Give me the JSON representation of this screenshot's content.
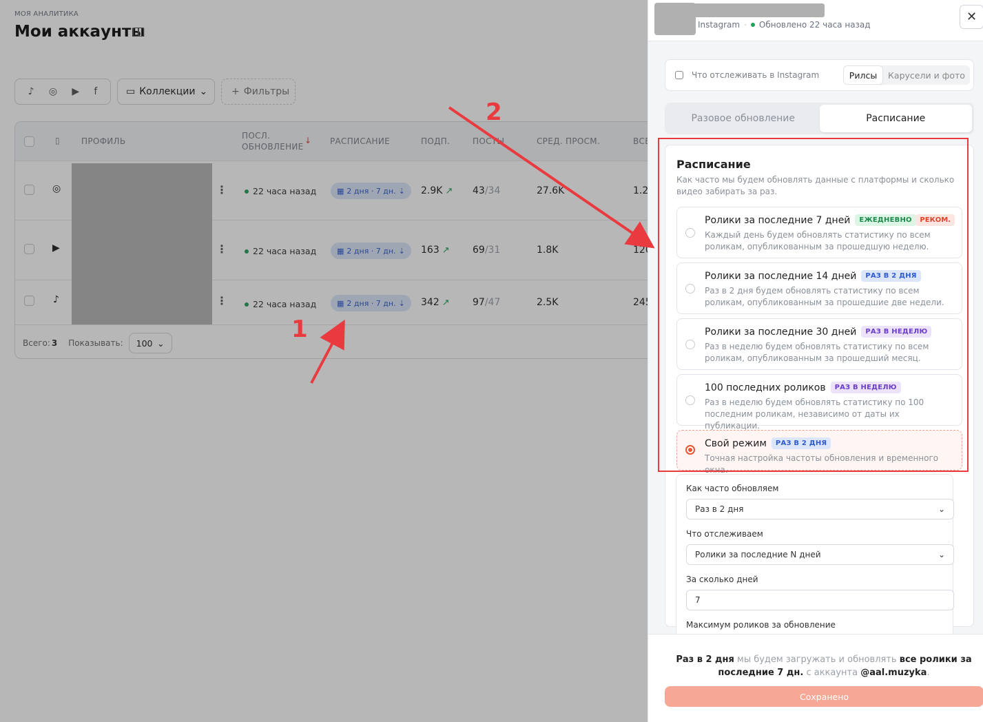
{
  "header": {
    "breadcrumb": "МОЯ АНАЛИТИКА",
    "title": "Мои аккаунты"
  },
  "toolbar": {
    "platforms": [
      "tiktok-icon",
      "instagram-icon",
      "youtube-icon",
      "facebook-icon"
    ],
    "collections_label": "Коллекции",
    "filters_label": "Фильтры"
  },
  "table": {
    "headers": {
      "profile": "ПРОФИЛЬ",
      "last_update_1": "ПОСЛ.",
      "last_update_2": "ОБНОВЛЕНИЕ",
      "schedule": "РАСПИСАНИЕ",
      "subs": "ПОДП.",
      "posts": "ПОСТЫ",
      "avg_views": "СРЕД. ПРОСМ.",
      "total": "ВСЕ"
    },
    "rows": [
      {
        "platform": "instagram",
        "updated": "22 часа назад",
        "schedule": "2 дня · 7 дн.",
        "subs": "2.9K",
        "posts_a": "43",
        "posts_b": "/34",
        "avg": "27.6K",
        "total": "1.2"
      },
      {
        "platform": "youtube",
        "updated": "22 часа назад",
        "schedule": "2 дня · 7 дн.",
        "subs": "163",
        "posts_a": "69",
        "posts_b": "/31",
        "avg": "1.8K",
        "total": "120"
      },
      {
        "platform": "tiktok",
        "updated": "22 часа назад",
        "schedule": "2 дня · 7 дн.",
        "subs": "342",
        "posts_a": "97",
        "posts_b": "/47",
        "avg": "2.5K",
        "total": "245"
      }
    ],
    "footer": {
      "total_label": "Всего:",
      "total_value": "3",
      "show_label": "Показывать:",
      "page_size": "100"
    }
  },
  "panel": {
    "platform": "Instagram",
    "updated": "Обновлено 22 часа назад",
    "track_label": "Что отслеживать в Instagram",
    "track_tabs": [
      "Рилсы",
      "Карусели и фото"
    ],
    "mode_tabs": [
      "Разовое обновление",
      "Расписание"
    ],
    "schedule": {
      "title": "Расписание",
      "desc": "Как часто мы будем обновлять данные с платформы и сколько видео забирать за раз.",
      "options": [
        {
          "title": "Ролики за последние 7 дней",
          "badge": "ЕЖЕДНЕВНО",
          "rec": "РЕКОМ.",
          "desc": "Каждый день будем обновлять статистику по всем роликам, опубликованным за прошедшую неделю."
        },
        {
          "title": "Ролики за последние 14 дней",
          "badge": "РАЗ В 2 ДНЯ",
          "desc": "Раз в 2 дня будем обновлять статистику по всем роликам, опубликованным за прошедшие две недели."
        },
        {
          "title": "Ролики за последние 30 дней",
          "badge": "РАЗ В НЕДЕЛЮ",
          "desc": "Раз в неделю будем обновлять статистику по всем роликам, опубликованным за прошедший месяц."
        },
        {
          "title": "100 последних роликов",
          "badge": "РАЗ В НЕДЕЛЮ",
          "desc": "Раз в неделю будем обновлять статистику по 100 последним роликам, независимо от даты их публикации."
        },
        {
          "title": "Свой режим",
          "badge": "РАЗ В 2 ДНЯ",
          "desc": "Точная настройка частоты обновления и временного окна."
        }
      ]
    },
    "custom": {
      "freq_label": "Как часто обновляем",
      "freq_value": "Раз в 2 дня",
      "what_label": "Что отслеживаем",
      "what_value": "Ролики за последние N дней",
      "days_label": "За сколько дней",
      "days_value": "7",
      "max_label": "Максимум роликов за обновление"
    },
    "summary": {
      "p1": "Раз в 2 дня",
      "p2": " мы будем загружать и обновлять ",
      "p3": "все ролики за последние 7 дн.",
      "p4": " с аккаунта ",
      "p5": "@aal.muzyka",
      "p6": "."
    },
    "save_label": "Сохранено"
  },
  "annotations": {
    "a1": "1",
    "a2": "2"
  },
  "colors": {
    "accent": "#e8542f",
    "annotation": "#e93a3f",
    "schedule_chip": "#dbe6fb"
  }
}
